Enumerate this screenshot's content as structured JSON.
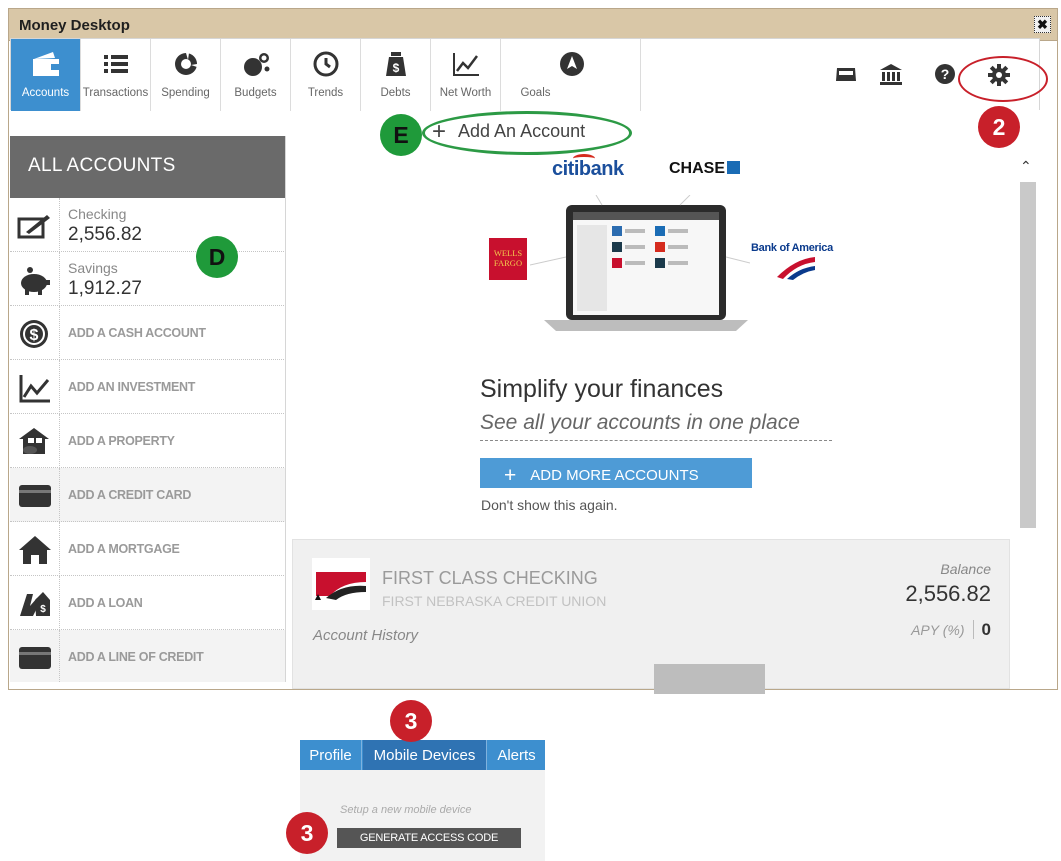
{
  "window": {
    "title": "Money Desktop",
    "close_glyph": "✖"
  },
  "nav": {
    "tabs": [
      {
        "label": "Accounts",
        "icon": "wallet-icon",
        "active": true
      },
      {
        "label": "Transactions",
        "icon": "list-icon"
      },
      {
        "label": "Spending",
        "icon": "pie-icon"
      },
      {
        "label": "Budgets",
        "icon": "bubbles-icon"
      },
      {
        "label": "Trends",
        "icon": "clock-icon"
      },
      {
        "label": "Debts",
        "icon": "money-bag-icon"
      },
      {
        "label": "Net Worth",
        "icon": "line-chart-icon"
      },
      {
        "label": "Goals",
        "icon": "compass-icon"
      }
    ],
    "tools": [
      "inbox-icon",
      "bank-icon",
      "help-icon",
      "gear-icon"
    ]
  },
  "sidebar": {
    "header": "ALL ACCOUNTS",
    "accounts": [
      {
        "name": "Checking",
        "balance": "2,556.82",
        "icon": "checkbook-icon"
      },
      {
        "name": "Savings",
        "balance": "1,912.27",
        "icon": "piggy-bank-icon"
      }
    ],
    "add_items": [
      {
        "label": "ADD A CASH ACCOUNT",
        "icon": "dollar-coin-icon"
      },
      {
        "label": "ADD AN INVESTMENT",
        "icon": "investment-chart-icon"
      },
      {
        "label": "ADD A PROPERTY",
        "icon": "property-icon"
      },
      {
        "label": "ADD A CREDIT CARD",
        "icon": "credit-card-icon"
      },
      {
        "label": "ADD A MORTGAGE",
        "icon": "house-icon"
      },
      {
        "label": "ADD A LOAN",
        "icon": "loan-icon"
      },
      {
        "label": "ADD A LINE OF CREDIT",
        "icon": "credit-line-icon"
      }
    ]
  },
  "main": {
    "add_account_label": "Add An Account",
    "hero_title": "Simplify your finances",
    "hero_subtitle": "See all your accounts in one place",
    "add_more_label": "ADD MORE ACCOUNTS",
    "dont_show": "Don't show this again.",
    "banks": {
      "citi": "citibank",
      "chase": "CHASE",
      "wells_line1": "WELLS",
      "wells_line2": "FARGO",
      "boa": "Bank of America"
    },
    "account_card": {
      "name": "FIRST CLASS CHECKING",
      "institution": "FIRST NEBRASKA CREDIT UNION",
      "balance_label": "Balance",
      "balance": "2,556.82",
      "apy_label": "APY (%)",
      "apy_value": "0",
      "history_label": "Account History"
    }
  },
  "snippet": {
    "tabs": [
      "Profile",
      "Mobile Devices",
      "Alerts"
    ],
    "hint": "Setup a new mobile device",
    "button": "GENERATE ACCESS CODE"
  },
  "markers": {
    "settings_step": "2",
    "mobile_tab_step": "3",
    "generate_step": "3",
    "accounts_marker": "D",
    "add_account_marker": "E"
  },
  "colors": {
    "titlebar": "#d9c7a7",
    "accent_blue": "#3d8fcf",
    "marker_red": "#c8202a",
    "marker_green": "#1f9a3a"
  }
}
